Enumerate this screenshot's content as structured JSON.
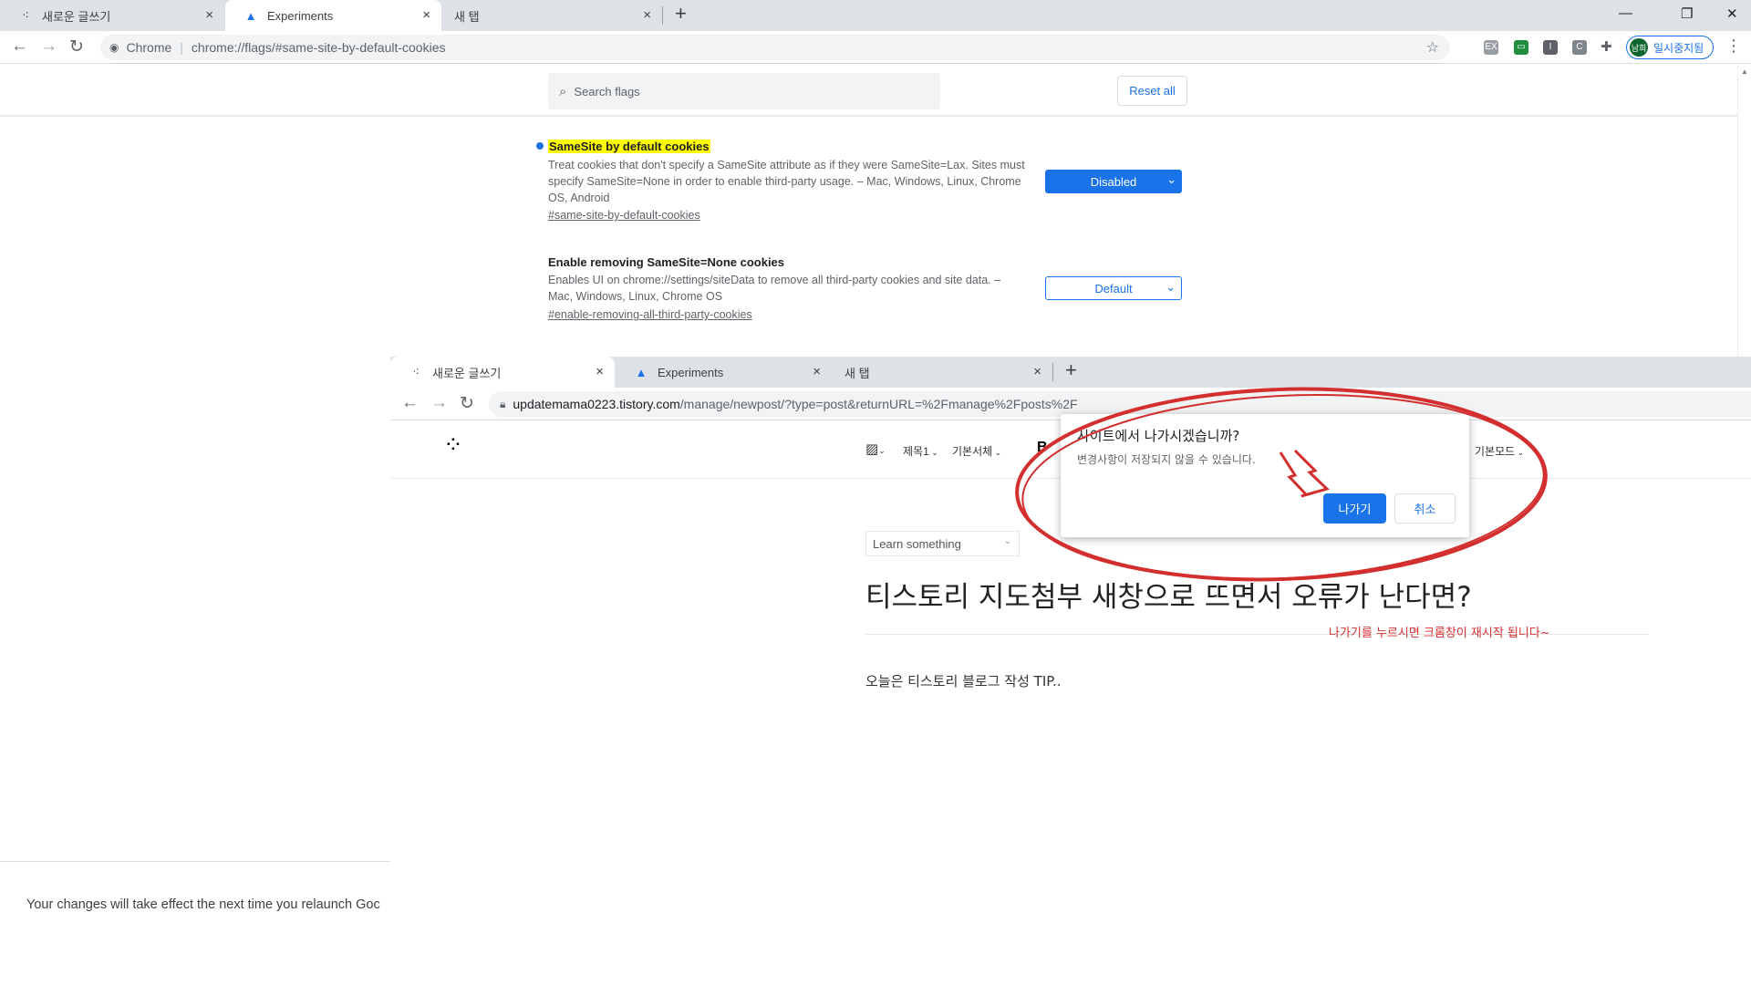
{
  "back_window": {
    "tabs": [
      {
        "label": "새로운 글쓰기",
        "close": "×"
      },
      {
        "label": "Experiments",
        "close": "×"
      },
      {
        "label": "새 탭",
        "close": "×"
      }
    ],
    "new_tab": "+",
    "window_controls": {
      "minimize": "—",
      "restore": "❐",
      "close": "✕"
    },
    "omnibox": {
      "site_label": "Chrome",
      "url": "chrome://flags/#same-site-by-default-cookies"
    },
    "extensions": [
      "EX",
      "▭",
      "I",
      "C"
    ],
    "profile": {
      "avatar": "남희",
      "label": "일시중지됨"
    },
    "menu": "⋮",
    "search": {
      "placeholder": "Search flags"
    },
    "reset_all": "Reset all",
    "flags": [
      {
        "title": "SameSite by default cookies",
        "description": "Treat cookies that don't specify a SameSite attribute as if they were SameSite=Lax. Sites must specify SameSite=None in order to enable third-party usage. – Mac, Windows, Linux, Chrome OS, Android",
        "link": "#same-site-by-default-cookies",
        "value": "Disabled",
        "highlighted": true
      },
      {
        "title": "Enable removing SameSite=None cookies",
        "description": "Enables UI on chrome://settings/siteData to remove all third-party cookies and site data. – Mac, Windows, Linux, Chrome OS",
        "link": "#enable-removing-all-third-party-cookies",
        "value": "Default",
        "highlighted": false
      }
    ],
    "relaunch_message": "Your changes will take effect the next time you relaunch Goc"
  },
  "front_window": {
    "tabs": [
      {
        "label": "새로운 글쓰기",
        "close": "×"
      },
      {
        "label": "Experiments",
        "close": "×"
      },
      {
        "label": "새 탭",
        "close": "×"
      }
    ],
    "new_tab": "+",
    "url_host": "updatemama0223.tistory.com",
    "url_path": "/manage/newpost/?type=post&returnURL=%2Fmanage%2Fposts%2F",
    "editor_tools": {
      "heading": "제목1",
      "font": "기본서체",
      "bold": "B",
      "mode": "기본모드"
    },
    "category": "Learn something",
    "post_title": "티스토리 지도첨부 새창으로 뜨면서 오류가 난다면?",
    "post_body": "오늘은 티스토리 블로그 작성 TIP..",
    "dialog": {
      "title": "사이트에서 나가시겠습니까?",
      "message": "변경사항이 저장되지 않을 수 있습니다.",
      "leave": "나가기",
      "cancel": "취소"
    }
  },
  "annotation": {
    "note": "나가기를 누르시면 크롬창이 재시작 됩니다~",
    "color": "#d32f2f"
  }
}
